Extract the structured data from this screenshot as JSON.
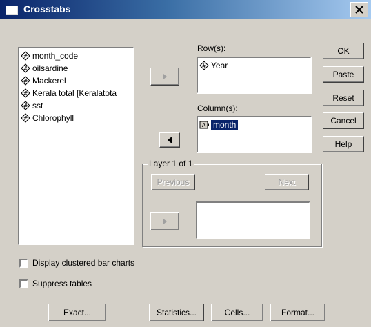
{
  "window": {
    "title": "Crosstabs"
  },
  "variables": [
    {
      "label": "month_code",
      "icon": "numeric-scale-icon"
    },
    {
      "label": "oilsardine",
      "icon": "numeric-scale-icon"
    },
    {
      "label": "Mackerel",
      "icon": "numeric-scale-icon"
    },
    {
      "label": "Kerala total [Keralatota",
      "icon": "numeric-scale-icon"
    },
    {
      "label": "sst",
      "icon": "numeric-scale-icon"
    },
    {
      "label": "Chlorophyll",
      "icon": "numeric-scale-icon"
    }
  ],
  "rows": {
    "label": "Row(s):",
    "items": [
      "Year"
    ]
  },
  "columns": {
    "label": "Column(s):",
    "items": [
      "month"
    ]
  },
  "layer": {
    "label": "Layer 1 of 1",
    "previous": "Previous",
    "next": "Next"
  },
  "buttons": {
    "ok": "OK",
    "paste": "Paste",
    "reset": "Reset",
    "cancel": "Cancel",
    "help": "Help"
  },
  "options": {
    "clustered_bar": {
      "label": "Display clustered bar charts",
      "checked": false
    },
    "suppress_tables": {
      "label": "Suppress tables",
      "checked": false
    }
  },
  "bottom_buttons": {
    "exact": "Exact...",
    "statistics": "Statistics...",
    "cells": "Cells...",
    "format": "Format..."
  }
}
